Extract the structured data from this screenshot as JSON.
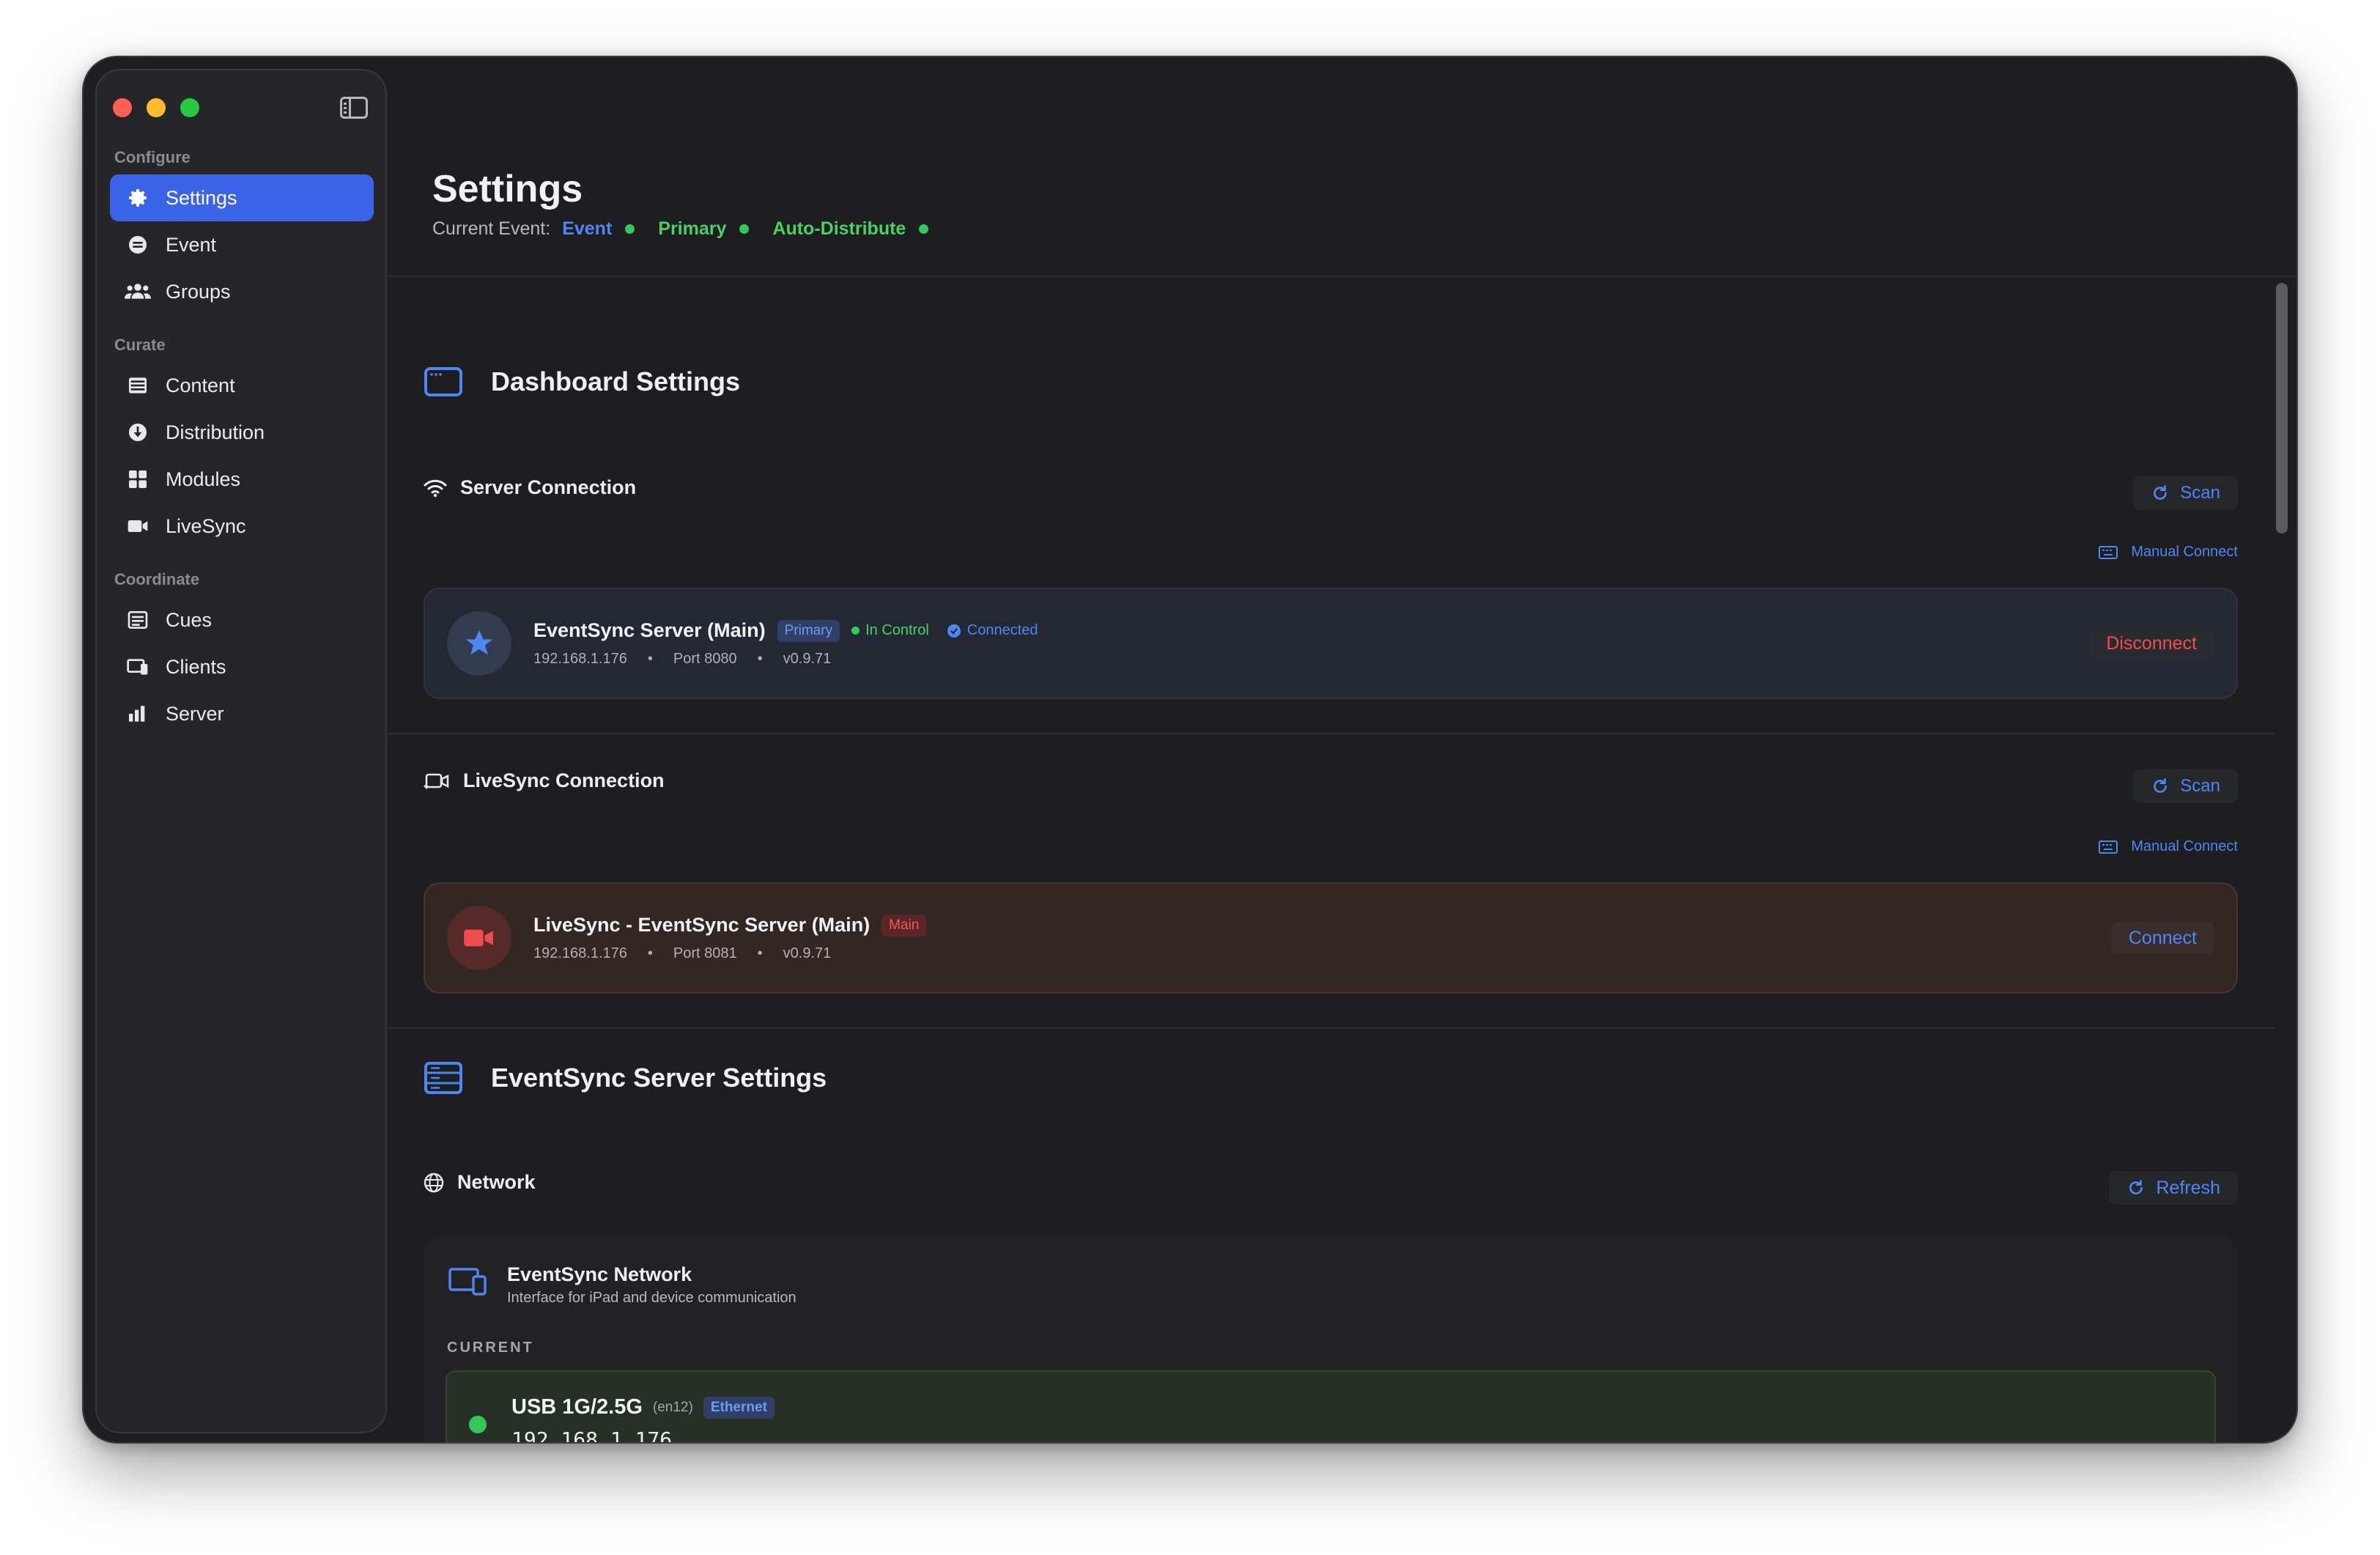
{
  "sidebar": {
    "sections": [
      {
        "label": "Configure",
        "items": [
          {
            "label": "Settings",
            "icon": "gear-icon",
            "active": true
          },
          {
            "label": "Event",
            "icon": "calendar-icon"
          },
          {
            "label": "Groups",
            "icon": "people-icon"
          }
        ]
      },
      {
        "label": "Curate",
        "items": [
          {
            "label": "Content",
            "icon": "list-icon"
          },
          {
            "label": "Distribution",
            "icon": "download-icon"
          },
          {
            "label": "Modules",
            "icon": "grid-icon"
          },
          {
            "label": "LiveSync",
            "icon": "video-camera-icon"
          }
        ]
      },
      {
        "label": "Coordinate",
        "items": [
          {
            "label": "Cues",
            "icon": "checklist-icon"
          },
          {
            "label": "Clients",
            "icon": "devices-icon"
          },
          {
            "label": "Server",
            "icon": "bar-chart-icon"
          }
        ]
      }
    ]
  },
  "header": {
    "title": "Settings",
    "current_event_label": "Current Event:",
    "tags": [
      "Event",
      "Primary",
      "Auto-Distribute"
    ]
  },
  "dashboard": {
    "title": "Dashboard Settings",
    "server_connection": {
      "title": "Server Connection",
      "scan_label": "Scan",
      "manual_connect_label": "Manual Connect",
      "server": {
        "name": "EventSync Server (Main)",
        "badge": "Primary",
        "status_control": "In Control",
        "status_connected": "Connected",
        "ip": "192.168.1.176",
        "port": "Port 8080",
        "version": "v0.9.71",
        "action": "Disconnect"
      }
    },
    "livesync_connection": {
      "title": "LiveSync Connection",
      "scan_label": "Scan",
      "manual_connect_label": "Manual Connect",
      "server": {
        "name": "LiveSync - EventSync Server (Main)",
        "badge": "Main",
        "ip": "192.168.1.176",
        "port": "Port 8081",
        "version": "v0.9.71",
        "action": "Connect"
      }
    }
  },
  "server_settings": {
    "title": "EventSync Server Settings",
    "network": {
      "title": "Network",
      "refresh_label": "Refresh",
      "card_title": "EventSync Network",
      "card_subtitle": "Interface for iPad and device communication",
      "current_label": "CURRENT",
      "interface": {
        "name": "USB 1G/2.5G",
        "device": "(en12)",
        "type": "Ethernet",
        "ip": "192.168.1.176"
      }
    }
  },
  "colors": {
    "accent": "#3a63e8",
    "link": "#4d86f5",
    "ok": "#34c759",
    "danger": "#ef4d4d"
  }
}
